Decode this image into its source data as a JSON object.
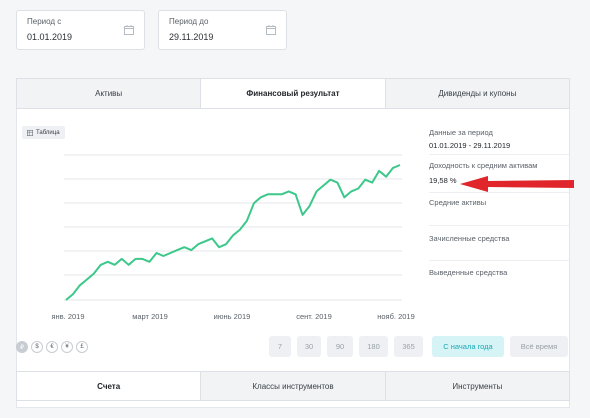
{
  "period_from": {
    "label": "Период с",
    "value": "01.01.2019",
    "icon": "calendar-icon"
  },
  "period_to": {
    "label": "Период до",
    "value": "29.11.2019",
    "icon": "calendar-icon"
  },
  "tabs": [
    {
      "label": "Активы",
      "active": false
    },
    {
      "label": "Финансовый результат",
      "active": true
    },
    {
      "label": "Дивиденды и купоны",
      "active": false
    }
  ],
  "table_button": {
    "label": "Таблица",
    "icon": "table-icon"
  },
  "chart_data": {
    "type": "line",
    "x_tick_labels": [
      "янв. 2019",
      "март 2019",
      "июнь 2019",
      "сент. 2019",
      "нояб. 2019"
    ],
    "series": [
      {
        "color": "#3cc88a",
        "values": [
          0,
          2,
          5,
          7,
          9,
          12,
          13,
          12,
          14,
          12,
          14,
          14,
          13,
          16,
          15,
          16,
          17,
          18,
          17,
          19,
          20,
          21,
          18,
          19,
          22,
          24,
          27,
          33,
          35,
          36,
          36,
          36,
          37,
          36,
          29,
          32,
          37,
          39,
          41,
          40,
          35,
          37,
          38,
          41,
          40,
          44,
          42,
          45,
          46
        ]
      }
    ],
    "grid": true
  },
  "side": {
    "period_key": "Данные за период",
    "period_val": "01.01.2019 - 29.11.2019",
    "yield_key": "Доходность к средним активам",
    "yield_val": "19,58 %",
    "avg_assets_key": "Средние активы",
    "credited_key": "Зачисленные средства",
    "withdrawn_key": "Выведенные средства"
  },
  "currencies": [
    "₽",
    "$",
    "€",
    "¥",
    "£"
  ],
  "period_buttons": [
    {
      "label": "7",
      "active": false
    },
    {
      "label": "30",
      "active": false
    },
    {
      "label": "90",
      "active": false
    },
    {
      "label": "180",
      "active": false
    },
    {
      "label": "365",
      "active": false
    },
    {
      "label": "С начала года",
      "active": true
    },
    {
      "label": "Всё время",
      "active": false
    }
  ],
  "bottom_tabs": [
    {
      "label": "Счета",
      "active": true
    },
    {
      "label": "Классы инструментов",
      "active": false
    },
    {
      "label": "Инструменты",
      "active": false
    }
  ],
  "arrow_color": "#e0262b"
}
